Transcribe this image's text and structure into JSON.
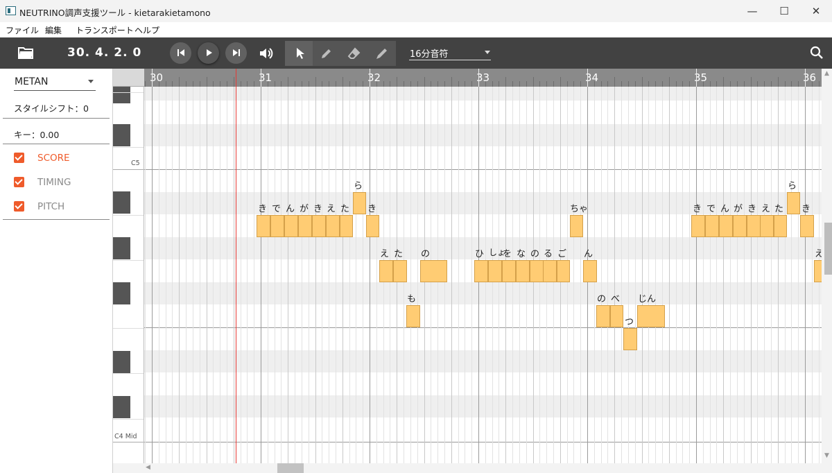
{
  "window": {
    "title": "NEUTRINO調声支援ツール - kietarakietamono",
    "minimize": "—",
    "maximize": "☐",
    "close": "✕"
  },
  "menu": {
    "items": [
      "ファイル",
      "編集",
      "トランスポート",
      "ヘルプ"
    ]
  },
  "toolbar": {
    "open_icon": "folder-icon",
    "position": "30. 4. 2. 0",
    "transport": [
      "skip-previous-icon",
      "play-icon",
      "skip-next-icon"
    ],
    "volume_icon": "volume-icon",
    "tools": [
      "cursor-icon",
      "pencil-icon",
      "eraser-icon",
      "pitch-pen-icon"
    ],
    "selected_tool": "cursor-icon",
    "division": "16分音符",
    "search_icon": "search-icon"
  },
  "sidebar": {
    "voice": "METAN",
    "style_shift": "スタイルシフト：0",
    "key": "キー：0.00",
    "checks": [
      {
        "label": "SCORE",
        "checked": true,
        "active": true
      },
      {
        "label": "TIMING",
        "checked": true,
        "active": false
      },
      {
        "label": "PITCH",
        "checked": true,
        "active": false
      }
    ],
    "accent": "#ef5b2b"
  },
  "keyboard": {
    "labels": [
      "C5",
      "C4 Mid"
    ]
  },
  "ruler": {
    "bars": [
      "30",
      "31",
      "32",
      "33",
      "34",
      "35",
      "36"
    ]
  },
  "notes_color": "#ffcc73",
  "lyrics": {
    "a": [
      "き",
      "で",
      "ん",
      "が",
      "き",
      "え",
      "た",
      "ら",
      "き"
    ],
    "b": [
      "え",
      "た",
      "も",
      "の"
    ],
    "c": [
      "ひ",
      "しょ",
      "を",
      "な",
      "の",
      "る",
      "ご",
      "ちゃ",
      "ん"
    ],
    "d": [
      "の",
      "べ",
      "つ",
      "じん"
    ],
    "e": [
      "き",
      "で",
      "ん",
      "が",
      "き",
      "え",
      "た",
      "ら",
      "き",
      "え"
    ]
  }
}
